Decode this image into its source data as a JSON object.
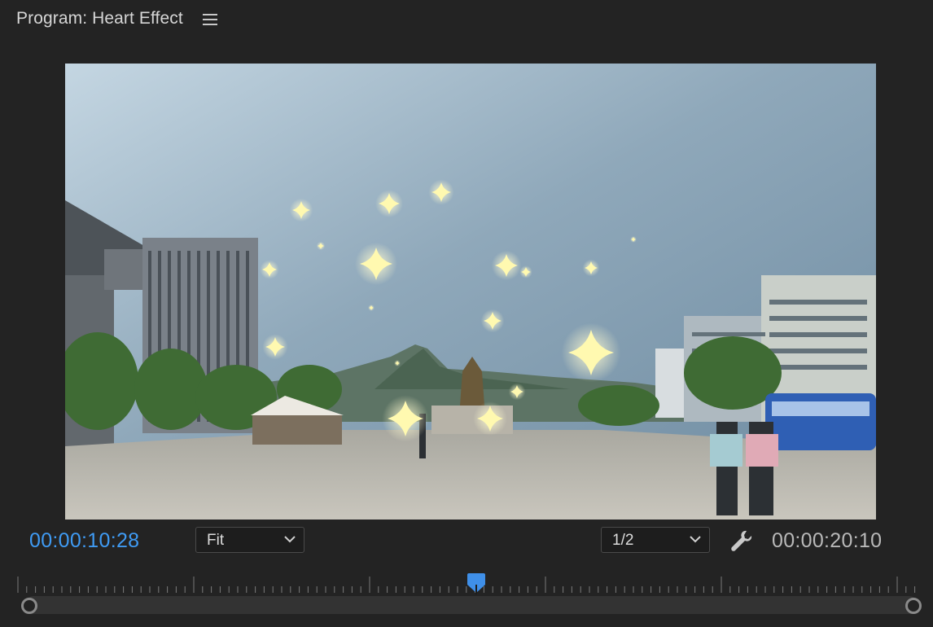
{
  "panel": {
    "title": "Program: Heart Effect",
    "menu_icon": "hamburger-icon"
  },
  "viewer": {
    "content": "video-frame",
    "effect_icon": "sparkle-icon"
  },
  "controls": {
    "current_timecode": "00:00:10:28",
    "duration_timecode": "00:00:20:10",
    "zoom": {
      "selected": "Fit"
    },
    "resolution": {
      "selected": "1/2"
    },
    "settings_icon": "wrench-icon"
  },
  "timeline": {
    "playhead_fraction": 0.51
  },
  "colors": {
    "accent": "#3f9bf4",
    "background": "#232323",
    "sparkle": "#fff9b0"
  }
}
